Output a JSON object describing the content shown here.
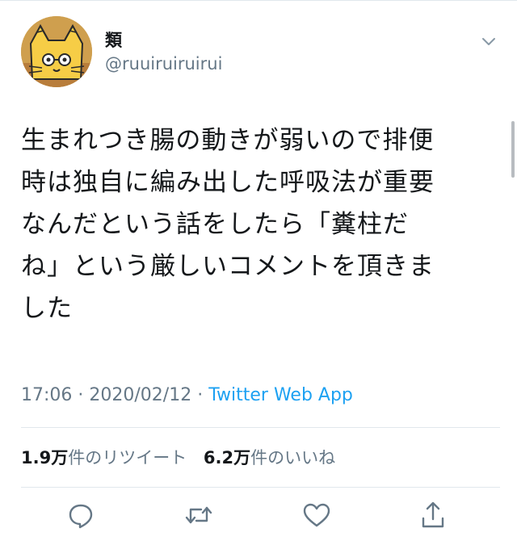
{
  "user": {
    "display_name": "類",
    "handle": "@ruuiruiruirui"
  },
  "tweet": {
    "lines": [
      "生まれつき腸の動きが弱いので排便",
      "時は独自に編み出した呼吸法が重要",
      "なんだという話をしたら「糞柱だ",
      "ね」という厳しいコメントを頂きま",
      "した"
    ]
  },
  "meta": {
    "time": "17:06",
    "separator": "·",
    "date": "2020/02/12",
    "source": "Twitter Web App"
  },
  "stats": {
    "retweets_count": "1.9万",
    "retweets_label": "件のリツイート",
    "likes_count": "6.2万",
    "likes_label": "件のいいね"
  },
  "actions": [
    "reply-icon",
    "retweet-icon",
    "like-icon",
    "share-icon"
  ],
  "colors": {
    "text": "#14171a",
    "secondary": "#657786",
    "link": "#1da1f2",
    "divider": "#e1e8ed"
  }
}
